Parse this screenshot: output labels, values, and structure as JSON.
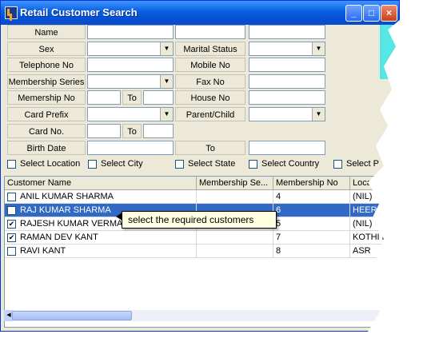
{
  "window": {
    "title": "Retail Customer Search"
  },
  "form": {
    "name_label": "Name",
    "sex_label": "Sex",
    "marital_status_label": "Marital Status",
    "telephone_label": "Telephone No",
    "mobile_label": "Mobile No",
    "membership_series_label": "Membership Series",
    "fax_label": "Fax No",
    "membership_no_label": "Memership No",
    "to_label": "To",
    "house_no_label": "House No",
    "card_prefix_label": "Card Prefix",
    "parent_child_label": "Parent/Child",
    "card_no_label": "Card No.",
    "birth_date_label": "Birth Date"
  },
  "filters": [
    "Select Location",
    "Select City",
    "Select State",
    "Select Country",
    "Select P"
  ],
  "grid": {
    "columns": [
      "Customer Name",
      "Membership Se...",
      "Membership No",
      "Loca"
    ],
    "rows": [
      {
        "name": "ANIL KUMAR SHARMA",
        "series": "",
        "number": "4",
        "location": "(NIL)",
        "checked": false,
        "selected": false
      },
      {
        "name": "RAJ KUMAR SHARMA",
        "series": "",
        "number": "6",
        "location": "HEERA",
        "checked": true,
        "selected": true
      },
      {
        "name": "RAJESH KUMAR VERMA",
        "series": "",
        "number": "5",
        "location": "(NIL)",
        "checked": true,
        "selected": false
      },
      {
        "name": "RAMAN DEV KANT",
        "series": "",
        "number": "7",
        "location": "KOTHI NO",
        "checked": true,
        "selected": false
      },
      {
        "name": "RAVI KANT",
        "series": "",
        "number": "8",
        "location": "ASR",
        "checked": false,
        "selected": false
      }
    ]
  },
  "tooltip": {
    "text": "select the required customers"
  },
  "colors": {
    "title_bar": "#0a5fde",
    "selected_row": "#316ac5",
    "accent_cyan": "#55e6e6",
    "tooltip_bg": "#ffffe1"
  }
}
